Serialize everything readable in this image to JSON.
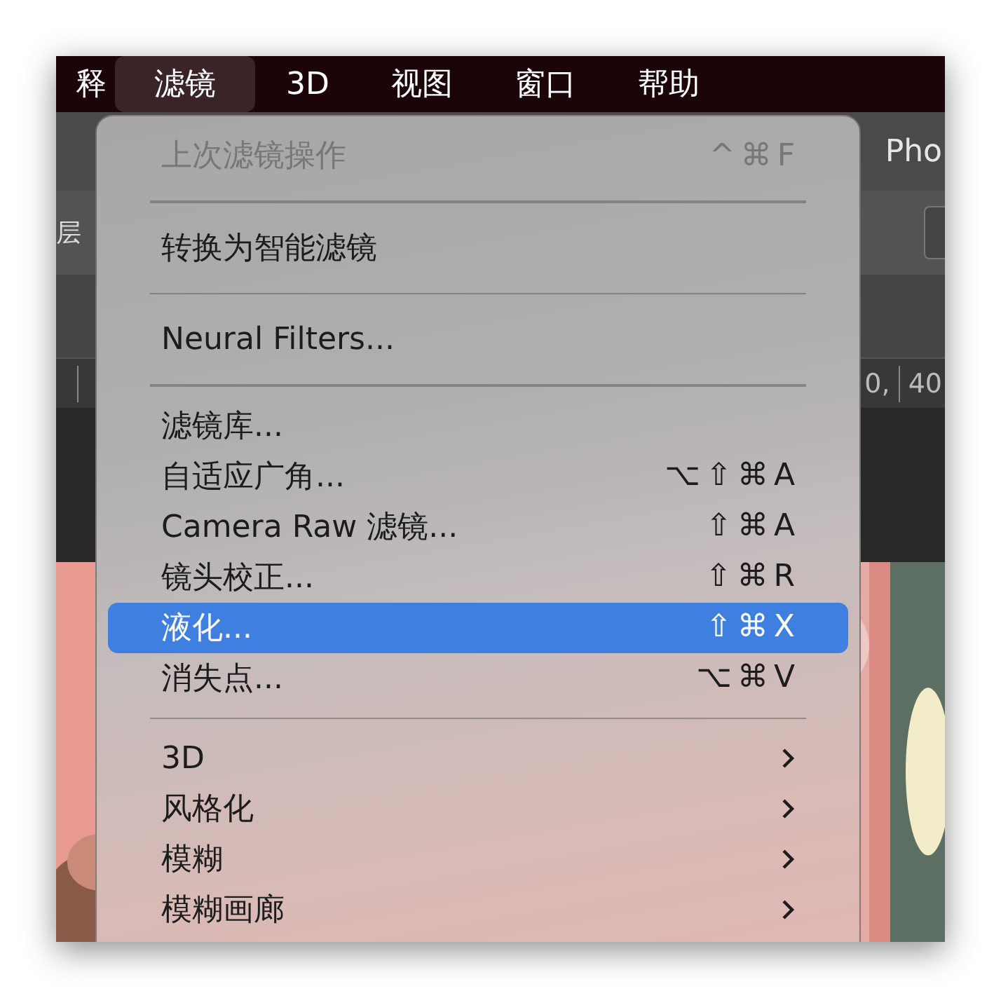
{
  "menu_bar": {
    "items": [
      {
        "label": "释",
        "selected": false
      },
      {
        "label": "滤镜",
        "selected": true
      },
      {
        "label": "3D",
        "selected": false
      },
      {
        "label": "视图",
        "selected": false
      },
      {
        "label": "窗口",
        "selected": false
      },
      {
        "label": "帮助",
        "selected": false
      }
    ]
  },
  "document_title": "Pho",
  "options_bar": {
    "label": "层"
  },
  "ruler": {
    "right_labels": [
      "0,",
      "40"
    ]
  },
  "filter_menu": {
    "sections": [
      [
        {
          "label": "上次滤镜操作",
          "shortcut": "^⌘F",
          "disabled": true,
          "selected": false,
          "submenu": false
        }
      ],
      [
        {
          "label": "转换为智能滤镜",
          "disabled": false,
          "selected": false,
          "submenu": false
        }
      ],
      [
        {
          "label": "Neural Filters...",
          "disabled": false,
          "selected": false,
          "submenu": false
        }
      ],
      [
        {
          "label": "滤镜库...",
          "disabled": false,
          "selected": false,
          "submenu": false
        },
        {
          "label": "自适应广角...",
          "shortcut": "⌥⇧⌘A",
          "disabled": false,
          "selected": false,
          "submenu": false
        },
        {
          "label": "Camera Raw 滤镜...",
          "shortcut": "⇧⌘A",
          "disabled": false,
          "selected": false,
          "submenu": false
        },
        {
          "label": "镜头校正...",
          "shortcut": "⇧⌘R",
          "disabled": false,
          "selected": false,
          "submenu": false
        },
        {
          "label": "液化...",
          "shortcut": "⇧⌘X",
          "disabled": false,
          "selected": true,
          "submenu": false
        },
        {
          "label": "消失点...",
          "shortcut": "⌥⌘V",
          "disabled": false,
          "selected": false,
          "submenu": false
        }
      ],
      [
        {
          "label": "3D",
          "disabled": false,
          "selected": false,
          "submenu": true
        },
        {
          "label": "风格化",
          "disabled": false,
          "selected": false,
          "submenu": true
        },
        {
          "label": "模糊",
          "disabled": false,
          "selected": false,
          "submenu": true
        },
        {
          "label": "模糊画廊",
          "disabled": false,
          "selected": false,
          "submenu": true
        }
      ]
    ]
  }
}
